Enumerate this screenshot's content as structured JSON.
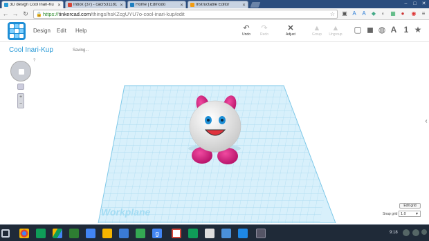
{
  "browser": {
    "tabs": [
      {
        "title": "3D design Cool Inari-Ku",
        "color": "#2a9ad6",
        "active": true
      },
      {
        "title": "Inbox (37) - cacr531181",
        "color": "#d44638",
        "active": false
      },
      {
        "title": "Home | Edmodo",
        "color": "#1f7fc0",
        "active": false
      },
      {
        "title": "Instructable Editor",
        "color": "#f39c12",
        "active": false
      }
    ],
    "url_scheme": "https://",
    "url_host": "tinkercad.com",
    "url_path": "/things/hsKZcgUYU7o-cool-inari-kup/edit"
  },
  "app": {
    "menu": [
      "Design",
      "Edit",
      "Help"
    ],
    "tools": [
      {
        "label": "Undo",
        "icon": "undo-icon",
        "enabled": true
      },
      {
        "label": "Redo",
        "icon": "redo-icon",
        "enabled": false
      },
      {
        "label": "Adjust",
        "icon": "adjust-icon",
        "enabled": true
      },
      {
        "label": "Group",
        "icon": "group-icon",
        "enabled": false
      },
      {
        "label": "Ungroup",
        "icon": "ungroup-icon",
        "enabled": false
      }
    ],
    "view_icons": [
      "wireframe-box-icon",
      "solid-box-icon",
      "shading-icon"
    ],
    "view_letter": "A",
    "view_number": "1",
    "project_title": "Cool Inari-Kup",
    "status": "Saving...",
    "nav_help": "?",
    "zoom_in": "+",
    "zoom_out": "−",
    "workplane_label": "Workplane",
    "edit_grid": "Edit grid",
    "snap_grid_label": "Snap grid",
    "snap_grid_value": "1.0",
    "accent": "#2a9ad6",
    "model_colors": {
      "body": "#f7f7f7",
      "ears": "#d6157c",
      "feet": "#d6157c",
      "eyes": "#1e8fd6",
      "mouth": "#e0333d"
    }
  },
  "taskbar": {
    "time": "9:18",
    "apps": [
      "chrome-icon",
      "sheets-icon",
      "drive-icon",
      "classroom-icon",
      "docs-icon",
      "slides-icon",
      "play-store-icon",
      "maps-icon",
      "search-icon",
      "gmail-icon",
      "download-icon",
      "crop-icon",
      "edge-icon",
      "photo-icon"
    ]
  }
}
